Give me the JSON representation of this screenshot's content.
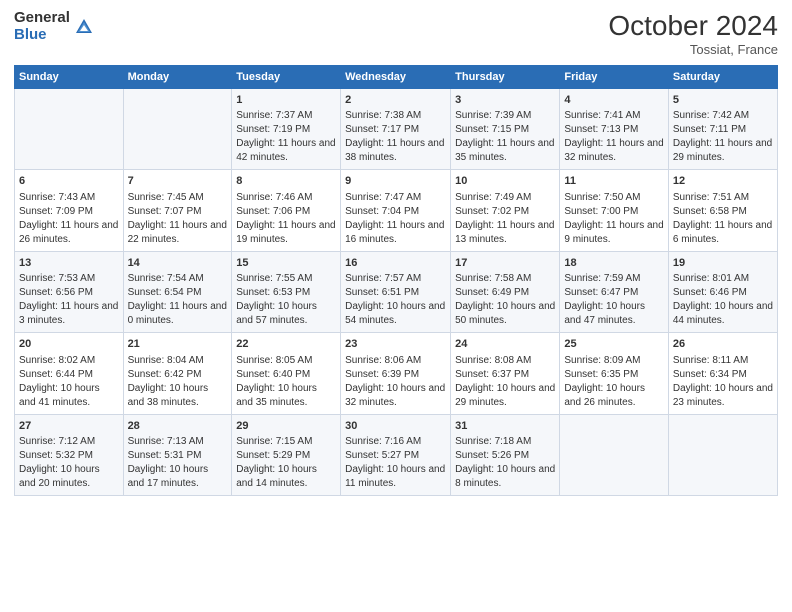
{
  "logo": {
    "general": "General",
    "blue": "Blue"
  },
  "header": {
    "month": "October 2024",
    "location": "Tossiat, France"
  },
  "weekdays": [
    "Sunday",
    "Monday",
    "Tuesday",
    "Wednesday",
    "Thursday",
    "Friday",
    "Saturday"
  ],
  "weeks": [
    [
      {
        "day": "",
        "sunrise": "",
        "sunset": "",
        "daylight": ""
      },
      {
        "day": "",
        "sunrise": "",
        "sunset": "",
        "daylight": ""
      },
      {
        "day": "1",
        "sunrise": "Sunrise: 7:37 AM",
        "sunset": "Sunset: 7:19 PM",
        "daylight": "Daylight: 11 hours and 42 minutes."
      },
      {
        "day": "2",
        "sunrise": "Sunrise: 7:38 AM",
        "sunset": "Sunset: 7:17 PM",
        "daylight": "Daylight: 11 hours and 38 minutes."
      },
      {
        "day": "3",
        "sunrise": "Sunrise: 7:39 AM",
        "sunset": "Sunset: 7:15 PM",
        "daylight": "Daylight: 11 hours and 35 minutes."
      },
      {
        "day": "4",
        "sunrise": "Sunrise: 7:41 AM",
        "sunset": "Sunset: 7:13 PM",
        "daylight": "Daylight: 11 hours and 32 minutes."
      },
      {
        "day": "5",
        "sunrise": "Sunrise: 7:42 AM",
        "sunset": "Sunset: 7:11 PM",
        "daylight": "Daylight: 11 hours and 29 minutes."
      }
    ],
    [
      {
        "day": "6",
        "sunrise": "Sunrise: 7:43 AM",
        "sunset": "Sunset: 7:09 PM",
        "daylight": "Daylight: 11 hours and 26 minutes."
      },
      {
        "day": "7",
        "sunrise": "Sunrise: 7:45 AM",
        "sunset": "Sunset: 7:07 PM",
        "daylight": "Daylight: 11 hours and 22 minutes."
      },
      {
        "day": "8",
        "sunrise": "Sunrise: 7:46 AM",
        "sunset": "Sunset: 7:06 PM",
        "daylight": "Daylight: 11 hours and 19 minutes."
      },
      {
        "day": "9",
        "sunrise": "Sunrise: 7:47 AM",
        "sunset": "Sunset: 7:04 PM",
        "daylight": "Daylight: 11 hours and 16 minutes."
      },
      {
        "day": "10",
        "sunrise": "Sunrise: 7:49 AM",
        "sunset": "Sunset: 7:02 PM",
        "daylight": "Daylight: 11 hours and 13 minutes."
      },
      {
        "day": "11",
        "sunrise": "Sunrise: 7:50 AM",
        "sunset": "Sunset: 7:00 PM",
        "daylight": "Daylight: 11 hours and 9 minutes."
      },
      {
        "day": "12",
        "sunrise": "Sunrise: 7:51 AM",
        "sunset": "Sunset: 6:58 PM",
        "daylight": "Daylight: 11 hours and 6 minutes."
      }
    ],
    [
      {
        "day": "13",
        "sunrise": "Sunrise: 7:53 AM",
        "sunset": "Sunset: 6:56 PM",
        "daylight": "Daylight: 11 hours and 3 minutes."
      },
      {
        "day": "14",
        "sunrise": "Sunrise: 7:54 AM",
        "sunset": "Sunset: 6:54 PM",
        "daylight": "Daylight: 11 hours and 0 minutes."
      },
      {
        "day": "15",
        "sunrise": "Sunrise: 7:55 AM",
        "sunset": "Sunset: 6:53 PM",
        "daylight": "Daylight: 10 hours and 57 minutes."
      },
      {
        "day": "16",
        "sunrise": "Sunrise: 7:57 AM",
        "sunset": "Sunset: 6:51 PM",
        "daylight": "Daylight: 10 hours and 54 minutes."
      },
      {
        "day": "17",
        "sunrise": "Sunrise: 7:58 AM",
        "sunset": "Sunset: 6:49 PM",
        "daylight": "Daylight: 10 hours and 50 minutes."
      },
      {
        "day": "18",
        "sunrise": "Sunrise: 7:59 AM",
        "sunset": "Sunset: 6:47 PM",
        "daylight": "Daylight: 10 hours and 47 minutes."
      },
      {
        "day": "19",
        "sunrise": "Sunrise: 8:01 AM",
        "sunset": "Sunset: 6:46 PM",
        "daylight": "Daylight: 10 hours and 44 minutes."
      }
    ],
    [
      {
        "day": "20",
        "sunrise": "Sunrise: 8:02 AM",
        "sunset": "Sunset: 6:44 PM",
        "daylight": "Daylight: 10 hours and 41 minutes."
      },
      {
        "day": "21",
        "sunrise": "Sunrise: 8:04 AM",
        "sunset": "Sunset: 6:42 PM",
        "daylight": "Daylight: 10 hours and 38 minutes."
      },
      {
        "day": "22",
        "sunrise": "Sunrise: 8:05 AM",
        "sunset": "Sunset: 6:40 PM",
        "daylight": "Daylight: 10 hours and 35 minutes."
      },
      {
        "day": "23",
        "sunrise": "Sunrise: 8:06 AM",
        "sunset": "Sunset: 6:39 PM",
        "daylight": "Daylight: 10 hours and 32 minutes."
      },
      {
        "day": "24",
        "sunrise": "Sunrise: 8:08 AM",
        "sunset": "Sunset: 6:37 PM",
        "daylight": "Daylight: 10 hours and 29 minutes."
      },
      {
        "day": "25",
        "sunrise": "Sunrise: 8:09 AM",
        "sunset": "Sunset: 6:35 PM",
        "daylight": "Daylight: 10 hours and 26 minutes."
      },
      {
        "day": "26",
        "sunrise": "Sunrise: 8:11 AM",
        "sunset": "Sunset: 6:34 PM",
        "daylight": "Daylight: 10 hours and 23 minutes."
      }
    ],
    [
      {
        "day": "27",
        "sunrise": "Sunrise: 7:12 AM",
        "sunset": "Sunset: 5:32 PM",
        "daylight": "Daylight: 10 hours and 20 minutes."
      },
      {
        "day": "28",
        "sunrise": "Sunrise: 7:13 AM",
        "sunset": "Sunset: 5:31 PM",
        "daylight": "Daylight: 10 hours and 17 minutes."
      },
      {
        "day": "29",
        "sunrise": "Sunrise: 7:15 AM",
        "sunset": "Sunset: 5:29 PM",
        "daylight": "Daylight: 10 hours and 14 minutes."
      },
      {
        "day": "30",
        "sunrise": "Sunrise: 7:16 AM",
        "sunset": "Sunset: 5:27 PM",
        "daylight": "Daylight: 10 hours and 11 minutes."
      },
      {
        "day": "31",
        "sunrise": "Sunrise: 7:18 AM",
        "sunset": "Sunset: 5:26 PM",
        "daylight": "Daylight: 10 hours and 8 minutes."
      },
      {
        "day": "",
        "sunrise": "",
        "sunset": "",
        "daylight": ""
      },
      {
        "day": "",
        "sunrise": "",
        "sunset": "",
        "daylight": ""
      }
    ]
  ]
}
